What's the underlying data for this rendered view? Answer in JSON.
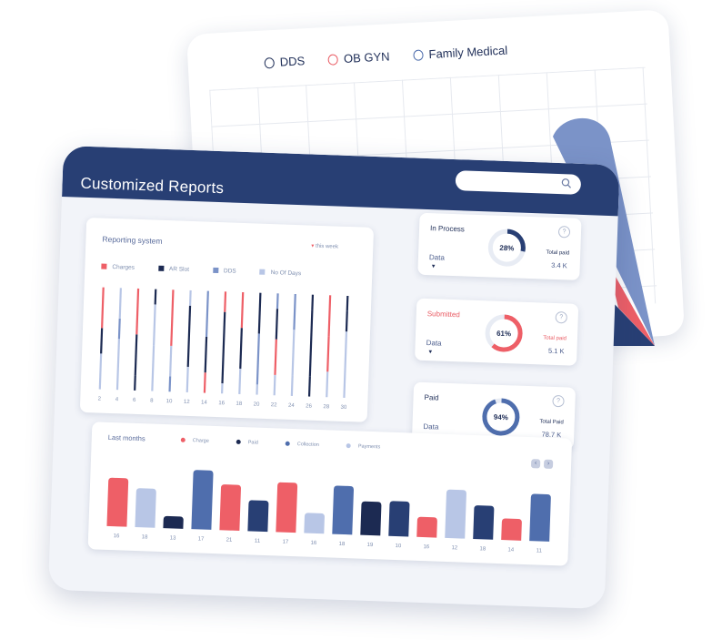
{
  "back": {
    "legend": [
      {
        "label": "DDS",
        "color": "#22315a"
      },
      {
        "label": "OB GYN",
        "color": "#e95b63"
      },
      {
        "label": "Family Medical",
        "color": "#4f6ead"
      }
    ]
  },
  "header": {
    "title": "Customized Reports"
  },
  "reporting": {
    "title": "Reporting system",
    "week_label": "this week",
    "legend": [
      {
        "label": "Charges",
        "color": "#ee5f67"
      },
      {
        "label": "AR Slot",
        "color": "#1c2a52"
      },
      {
        "label": "DDS",
        "color": "#7b93c8"
      },
      {
        "label": "No Of Days",
        "color": "#b8c6e6"
      }
    ],
    "x_labels": [
      "2",
      "4",
      "6",
      "8",
      "10",
      "12",
      "14",
      "16",
      "18",
      "20",
      "22",
      "24",
      "26",
      "28",
      "30"
    ]
  },
  "stats": [
    {
      "name": "In Process",
      "name_color": "#22315a",
      "data_label": "Data",
      "percent": 28,
      "percent_text": "28%",
      "ring_color": "#283f74",
      "total_label": "Total paid",
      "total_value": "3.4 K"
    },
    {
      "name": "Submitted",
      "name_color": "#e95b63",
      "data_label": "Data",
      "percent": 61,
      "percent_text": "61%",
      "ring_color": "#ee5f67",
      "total_label": "Total paid",
      "total_value": "5.1 K"
    },
    {
      "name": "Paid",
      "name_color": "#22315a",
      "data_label": "Data",
      "percent": 94,
      "percent_text": "94%",
      "ring_color": "#4f6ead",
      "total_label": "Total Paid",
      "total_value": "78.7 K"
    }
  ],
  "last_months": {
    "title": "Last months",
    "legend": [
      {
        "label": "Charge",
        "color": "#ee5f67"
      },
      {
        "label": "Paid",
        "color": "#1c2a52"
      },
      {
        "label": "Collection",
        "color": "#4f6ead"
      },
      {
        "label": "Payments",
        "color": "#b8c6e6"
      }
    ],
    "prev_icon": "chevron-left-icon",
    "next_icon": "chevron-right-icon"
  },
  "chart_data": [
    {
      "type": "bar",
      "title": "Last months",
      "categories": [
        "16",
        "18",
        "13",
        "17",
        "21",
        "11",
        "17",
        "16",
        "18",
        "19",
        "10",
        "16",
        "12",
        "18",
        "14",
        "11"
      ],
      "values": [
        72,
        58,
        18,
        88,
        68,
        46,
        74,
        30,
        72,
        50,
        52,
        30,
        72,
        50,
        32,
        70
      ],
      "colors": [
        "#ee5f67",
        "#b8c6e6",
        "#1c2a52",
        "#4f6ead",
        "#ee5f67",
        "#283f74",
        "#ee5f67",
        "#b8c6e6",
        "#4f6ead",
        "#1c2a52",
        "#283f74",
        "#ee5f67",
        "#b8c6e6",
        "#283f74",
        "#ee5f67",
        "#4f6ead"
      ],
      "ylim": [
        0,
        100
      ]
    }
  ]
}
